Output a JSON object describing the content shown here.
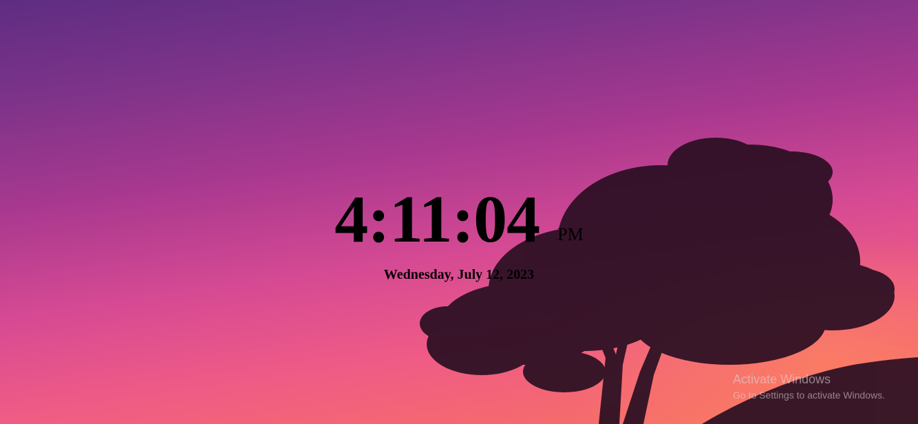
{
  "clock": {
    "time": "4:11:04",
    "period": "PM",
    "date": "Wednesday, July 12, 2023"
  },
  "watermark": {
    "title": "Activate Windows",
    "subtitle": "Go to Settings to activate Windows."
  },
  "wallpaper": {
    "subject": "tree-silhouette-at-sunset",
    "colors": {
      "sky_top": "#5e2d82",
      "sky_mid": "#d64a93",
      "sky_bottom": "#f77a62",
      "silhouette": "#2a0f22"
    }
  }
}
